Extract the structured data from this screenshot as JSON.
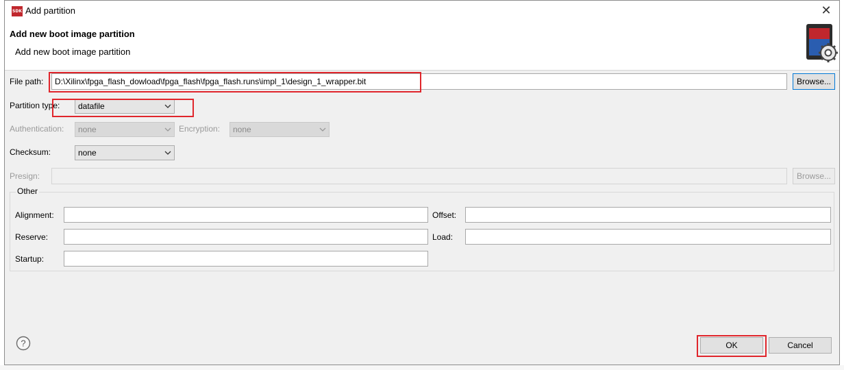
{
  "window": {
    "title": "Add partition",
    "app_icon_label": "SDK",
    "close_glyph": "✕"
  },
  "header": {
    "title": "Add new boot image partition",
    "message": "Add new boot image partition"
  },
  "form": {
    "file_path": {
      "label": "File path:",
      "value": "D:\\Xilinx\\fpga_flash_dowload\\fpga_flash\\fpga_flash.runs\\impl_1\\design_1_wrapper.bit",
      "browse_label": "Browse..."
    },
    "partition_type": {
      "label": "Partition type:",
      "value": "datafile"
    },
    "authentication": {
      "label": "Authentication:",
      "value": "none"
    },
    "encryption": {
      "label": "Encryption:",
      "value": "none"
    },
    "checksum": {
      "label": "Checksum:",
      "value": "none"
    },
    "presign": {
      "label": "Presign:",
      "value": "",
      "browse_label": "Browse..."
    }
  },
  "other": {
    "title": "Other",
    "alignment": {
      "label": "Alignment:",
      "value": ""
    },
    "offset": {
      "label": "Offset:",
      "value": ""
    },
    "reserve": {
      "label": "Reserve:",
      "value": ""
    },
    "load": {
      "label": "Load:",
      "value": ""
    },
    "startup": {
      "label": "Startup:",
      "value": ""
    }
  },
  "footer": {
    "help_glyph": "?",
    "ok_label": "OK",
    "cancel_label": "Cancel"
  },
  "colors": {
    "highlight": "#e0252b",
    "focus": "#0078d7",
    "dialog_bg": "#f0f0f0"
  },
  "icons": [
    "sdk-app-icon",
    "close-icon",
    "boot-image-gear-icon",
    "chevron-down-icon",
    "help-icon"
  ]
}
